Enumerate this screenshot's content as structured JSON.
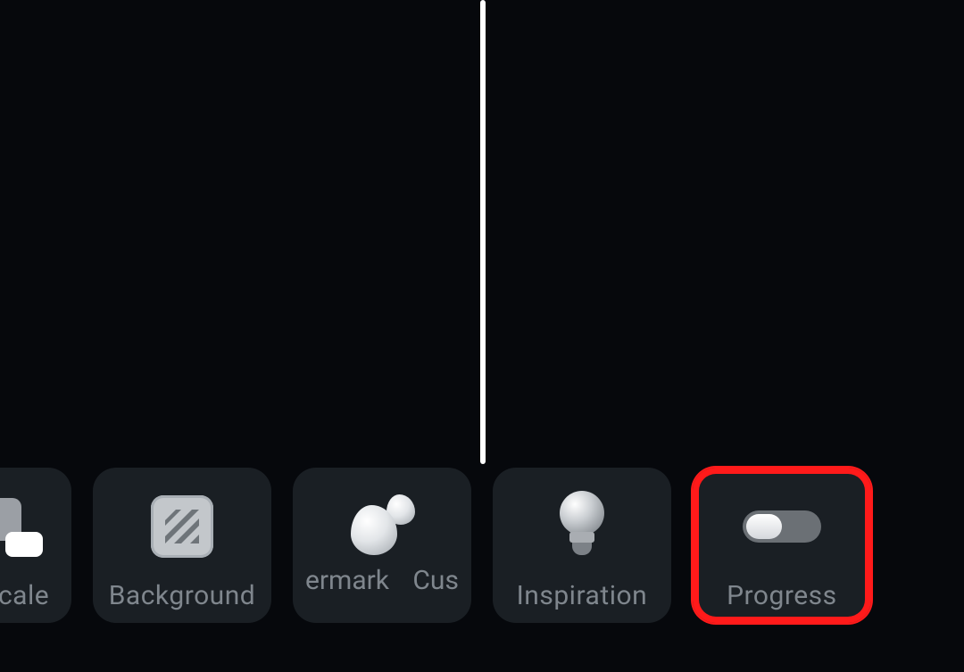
{
  "divider": {
    "visible": true
  },
  "toolbar": {
    "items": [
      {
        "id": "scale",
        "label": "scale",
        "icon": "scale-icon",
        "highlighted": false
      },
      {
        "id": "background",
        "label": "Background",
        "icon": "background-icon",
        "highlighted": false
      },
      {
        "id": "watermark",
        "label_left": "ermark",
        "label_right": "Cus",
        "icon": "watermark-icon",
        "highlighted": false
      },
      {
        "id": "inspiration",
        "label": "Inspiration",
        "icon": "lightbulb-icon",
        "highlighted": false
      },
      {
        "id": "progress",
        "label": "Progress",
        "icon": "toggle-icon",
        "highlighted": true
      }
    ]
  },
  "colors": {
    "background": "#06080c",
    "tile": "#1a1f24",
    "label": "#7f868d",
    "highlight": "#ff1a1a"
  }
}
